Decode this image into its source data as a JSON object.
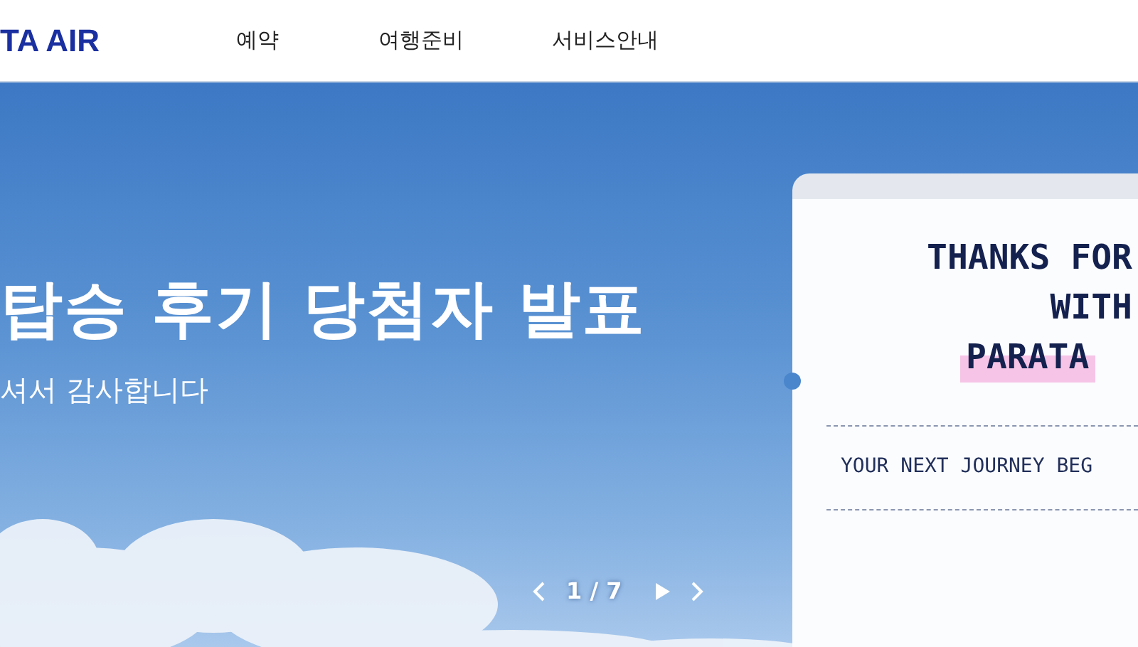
{
  "header": {
    "logo": "TA AIR",
    "nav": [
      {
        "label": "예약"
      },
      {
        "label": "여행준비"
      },
      {
        "label": "서비스안내"
      }
    ]
  },
  "hero": {
    "title": "탑승 후기 당첨자 발표",
    "subtitle": "셔서 감사합니다",
    "card": {
      "lines": [
        "THANKS FOR",
        "WITH"
      ],
      "highlight": "PARATA",
      "footer": "YOUR NEXT JOURNEY BEG"
    },
    "pager": {
      "current": "1 / 7"
    }
  }
}
